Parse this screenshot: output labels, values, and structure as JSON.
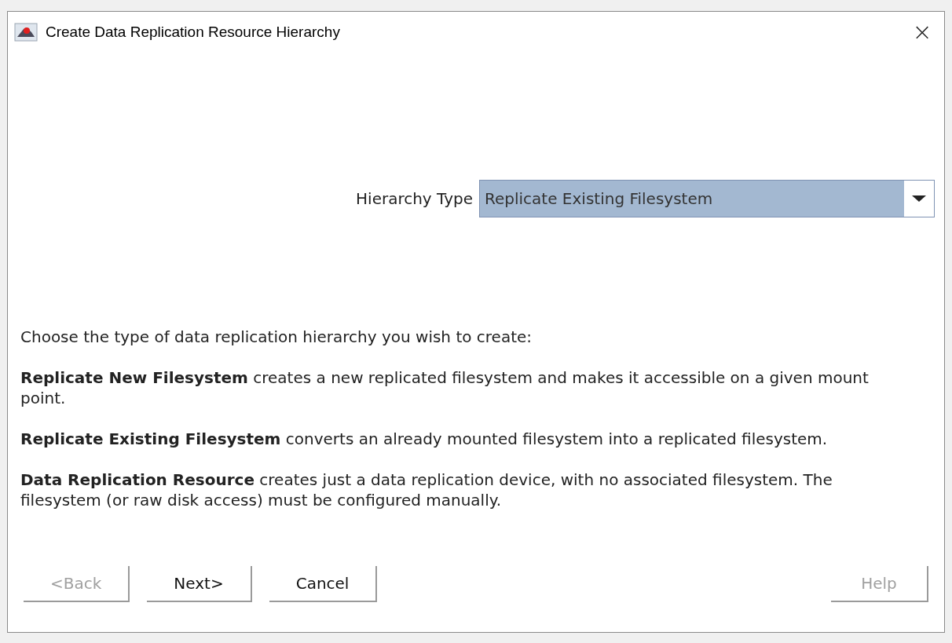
{
  "window": {
    "title": "Create Data Replication Resource Hierarchy",
    "close": "×"
  },
  "hierarchy_type": {
    "label": "Hierarchy Type",
    "value": "Replicate Existing Filesystem"
  },
  "intro": "Choose the type of data replication hierarchy you wish to create:",
  "descriptions": [
    "**Replicate New Filesystem** creates a new replicated filesystem and makes it accessible on a given mount point.",
    "**Replicate Existing Filesystem** converts an already mounted filesystem into a replicated filesystem.",
    "**Data Replication Resource** creates just a data replication device, with no associated filesystem. The filesystem (or raw disk access) must be configured manually."
  ],
  "buttons": [
    {
      "label": "<Back",
      "disabled": true,
      "kind": "left"
    },
    {
      "label": "Next>",
      "disabled": false,
      "kind": "left"
    },
    {
      "label": "Cancel",
      "disabled": false,
      "kind": "left"
    },
    {
      "label": "Help",
      "disabled": true,
      "kind": "right"
    }
  ]
}
